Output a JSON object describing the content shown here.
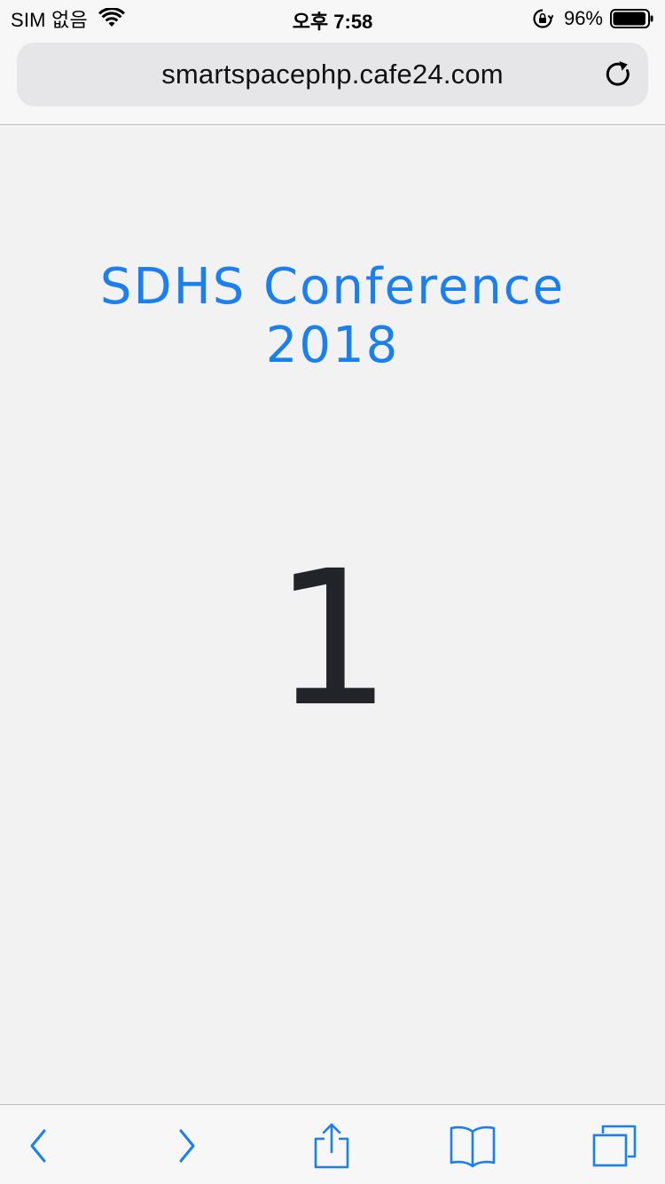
{
  "status_bar": {
    "carrier": "SIM 없음",
    "time": "오후 7:58",
    "battery_percent": "96%",
    "battery_level": 0.96,
    "icons": [
      "wifi-icon",
      "lock-rotation-icon",
      "battery-icon"
    ]
  },
  "browser": {
    "url": "smartspacephp.cafe24.com",
    "reload_icon": "reload-icon"
  },
  "page": {
    "title_line1": "SDHS Conference",
    "title_line2": "2018",
    "counter": "1",
    "title_color": "#1a7ff0",
    "counter_color": "#212529"
  },
  "toolbar": {
    "accent_color": "#1a7ff0",
    "buttons": [
      "back-icon",
      "forward-icon",
      "share-icon",
      "bookmarks-icon",
      "tabs-icon"
    ]
  }
}
